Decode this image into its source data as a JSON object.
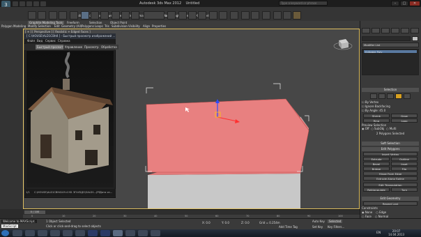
{
  "app": {
    "title": "Autodesk 3ds Max 2012",
    "doc": "Untitled",
    "search_placeholder": "Type a keyword or phrase"
  },
  "menu": [
    "Edit",
    "Tools",
    "Group",
    "Views",
    "Create",
    "Modifiers",
    "Animation",
    "Graph Editors",
    "Rendering",
    "Customize",
    "MAXScript",
    "Help"
  ],
  "graphite": {
    "tabs": [
      "Graphite Modeling Tools",
      "Freeform",
      "Selection",
      "Object Paint"
    ],
    "active": "Graphite Modeling Tools",
    "subtabs": [
      "Polygon Modeling",
      "Modify Selection",
      "Edit",
      "Geometry (All)",
      "Polygons",
      "Loops",
      "Tris",
      "Subdivision",
      "Visibility",
      "Align",
      "Properties"
    ]
  },
  "viewport": {
    "label": "[ + ] [ Perspective ] [ Realistic + Edged Faces ]"
  },
  "image_window": {
    "title": "[ C:\\HOUSE\\ALD1CBH4 ] - Быстрый просмотр изображений ...",
    "menu": [
      "Файл",
      "Вид",
      "Сервис",
      "Справка"
    ],
    "tabs": [
      "Быстрый просмотр",
      "Управление",
      "Просмотр",
      "Обработка"
    ],
    "active_tab": "Быстрый просмотр",
    "status": [
      "1/1",
      "C:\\HOUSE\\ALD1CBH4",
      "149.4 КБ",
      "ЗП:ИЗДО\\3ALD1...JPG",
      "Дата из..."
    ]
  },
  "right_panel": {
    "modifier_list": "Modifier List",
    "stack_item": "Editable Poly",
    "selection_head": "Selection",
    "by_vertex": "By Vertex",
    "ignore_backfacing": "Ignore Backfacing",
    "by_angle": "By Angle:",
    "angle_value": "45.0",
    "shrink": "Shrink",
    "grow": "Grow",
    "ring": "Ring",
    "loop": "Loop",
    "preview_selection": "Preview Selection",
    "preview_off": "Off",
    "preview_subobj": "SubObj",
    "preview_multi": "Multi",
    "selected_info": "2 Polygons Selected",
    "soft_selection": "Soft Selection",
    "edit_polygons": "Edit Polygons",
    "insert_vertex": "Insert Vertex",
    "buttons": [
      [
        "Extrude",
        "Outline"
      ],
      [
        "Bevel",
        "Inset"
      ],
      [
        "Bridge",
        "Flip"
      ]
    ],
    "hinge": "Hinge From Edge",
    "extrude_spline": "Extrude Along Spline",
    "edit_triangulation": "Edit Triangulation",
    "retriangulate": "Retriangulate",
    "turn": "Turn",
    "edit_geometry": "Edit Geometry",
    "repeat_last": "Repeat Last",
    "constraints": "Constraints",
    "none": "None",
    "edge": "Edge",
    "face": "Face",
    "normal": "Normal"
  },
  "timeline": {
    "ticks": [
      "0",
      "10",
      "20",
      "30",
      "40",
      "50",
      "60",
      "70",
      "80",
      "90",
      "100"
    ],
    "position": "0 / 100"
  },
  "status": {
    "object_selected": "1 Object Selected",
    "hint": "Click or click-and-drag to select objects",
    "x": "X: 0.0",
    "y": "Y: 0.0",
    "z": "Z: 0.0",
    "grid": "Grid = 0.254m",
    "auto_key": "Auto Key",
    "selected": "Selected",
    "set_key": "Set Key",
    "key_filters": "Key Filters...",
    "add_time_tag": "Add Time Tag",
    "welcome": "Welcome to MAXScript.",
    "maxscript": "MaxScript"
  },
  "taskbar": {
    "lang": "EN",
    "time": "20:07",
    "date": "14.04.2013"
  }
}
